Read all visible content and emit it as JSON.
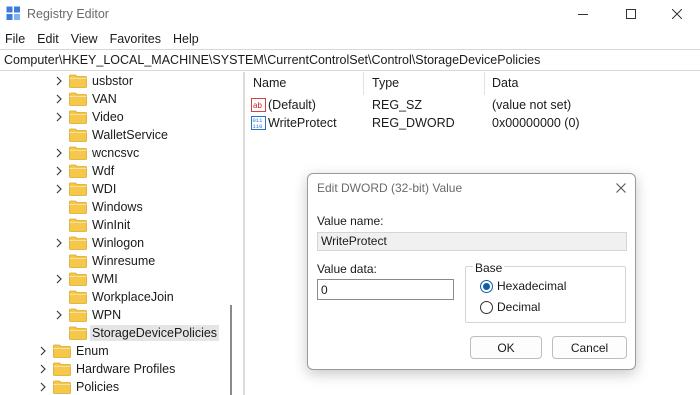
{
  "window": {
    "title": "Registry Editor",
    "icon": "registry-icon"
  },
  "menu": [
    "File",
    "Edit",
    "View",
    "Favorites",
    "Help"
  ],
  "address": "Computer\\HKEY_LOCAL_MACHINE\\SYSTEM\\CurrentControlSet\\Control\\StorageDevicePolicies",
  "tree": {
    "items": [
      {
        "label": "usbstor",
        "expandable": true
      },
      {
        "label": "VAN",
        "expandable": true
      },
      {
        "label": "Video",
        "expandable": true
      },
      {
        "label": "WalletService",
        "expandable": false
      },
      {
        "label": "wcncsvc",
        "expandable": true
      },
      {
        "label": "Wdf",
        "expandable": true
      },
      {
        "label": "WDI",
        "expandable": true
      },
      {
        "label": "Windows",
        "expandable": false
      },
      {
        "label": "WinInit",
        "expandable": false
      },
      {
        "label": "Winlogon",
        "expandable": true
      },
      {
        "label": "Winresume",
        "expandable": false
      },
      {
        "label": "WMI",
        "expandable": true
      },
      {
        "label": "WorkplaceJoin",
        "expandable": false
      },
      {
        "label": "WPN",
        "expandable": true
      },
      {
        "label": "StorageDevicePolicies",
        "expandable": false,
        "selected": true
      },
      {
        "label": "Enum",
        "expandable": true
      },
      {
        "label": "Hardware Profiles",
        "expandable": true
      },
      {
        "label": "Policies",
        "expandable": true
      }
    ]
  },
  "list": {
    "columns": [
      "Name",
      "Type",
      "Data"
    ],
    "rows": [
      {
        "name": "(Default)",
        "type": "REG_SZ",
        "data": "(value not set)",
        "icon": "string-value-icon"
      },
      {
        "name": "WriteProtect",
        "type": "REG_DWORD",
        "data": "0x00000000 (0)",
        "icon": "binary-value-icon"
      }
    ]
  },
  "dialog": {
    "title": "Edit DWORD (32-bit) Value",
    "value_name_label": "Value name:",
    "value_name": "WriteProtect",
    "value_data_label": "Value data:",
    "value_data": "0",
    "base_label": "Base",
    "hex_label": "Hexadecimal",
    "dec_label": "Decimal",
    "base_selected": "Hexadecimal",
    "ok_label": "OK",
    "cancel_label": "Cancel"
  },
  "colors": {
    "folder": "#f5c84c",
    "accent": "#0f5ea8",
    "selection": "#e5e5e5"
  }
}
